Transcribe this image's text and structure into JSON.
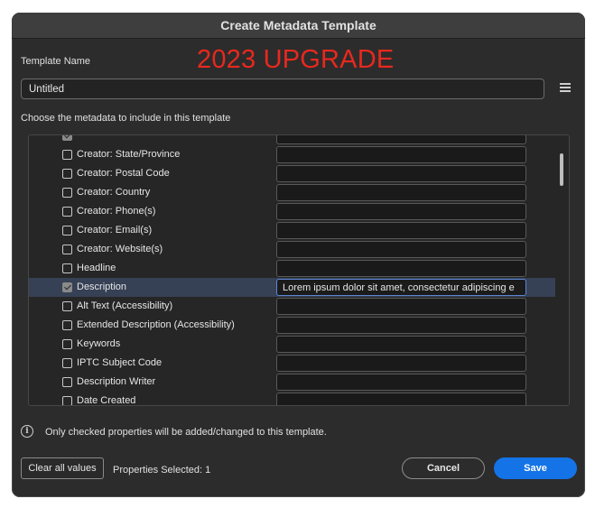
{
  "dialog": {
    "title": "Create Metadata Template",
    "overlay_text": "2023 UPGRADE",
    "template_name_label": "Template Name",
    "template_name_value": "Untitled",
    "menu_icon": "hamburger-menu-icon",
    "choose_label": "Choose the metadata to include in this template",
    "rows": [
      {
        "label": "",
        "checked": true,
        "value": "",
        "selected": false
      },
      {
        "label": "Creator: State/Province",
        "checked": false,
        "value": "",
        "selected": false
      },
      {
        "label": "Creator: Postal Code",
        "checked": false,
        "value": "",
        "selected": false
      },
      {
        "label": "Creator: Country",
        "checked": false,
        "value": "",
        "selected": false
      },
      {
        "label": "Creator: Phone(s)",
        "checked": false,
        "value": "",
        "selected": false
      },
      {
        "label": "Creator: Email(s)",
        "checked": false,
        "value": "",
        "selected": false
      },
      {
        "label": "Creator: Website(s)",
        "checked": false,
        "value": "",
        "selected": false
      },
      {
        "label": "Headline",
        "checked": false,
        "value": "",
        "selected": false
      },
      {
        "label": "Description",
        "checked": true,
        "value": "Lorem ipsum dolor sit amet, consectetur adipiscing e",
        "selected": true
      },
      {
        "label": "Alt Text (Accessibility)",
        "checked": false,
        "value": "",
        "selected": false
      },
      {
        "label": "Extended Description (Accessibility)",
        "checked": false,
        "value": "",
        "selected": false
      },
      {
        "label": "Keywords",
        "checked": false,
        "value": "",
        "selected": false
      },
      {
        "label": "IPTC Subject Code",
        "checked": false,
        "value": "",
        "selected": false
      },
      {
        "label": "Description Writer",
        "checked": false,
        "value": "",
        "selected": false
      },
      {
        "label": "Date Created",
        "checked": false,
        "value": "",
        "selected": false
      }
    ],
    "info_icon": "info-circle-icon",
    "info_text": "Only checked properties will be added/changed to this template.",
    "clear_button": "Clear all values",
    "properties_selected": "Properties Selected: 1",
    "cancel_button": "Cancel",
    "save_button": "Save",
    "colors": {
      "accent": "#1473e6",
      "overlay": "#e8281e",
      "selected_row": "#364155"
    }
  }
}
